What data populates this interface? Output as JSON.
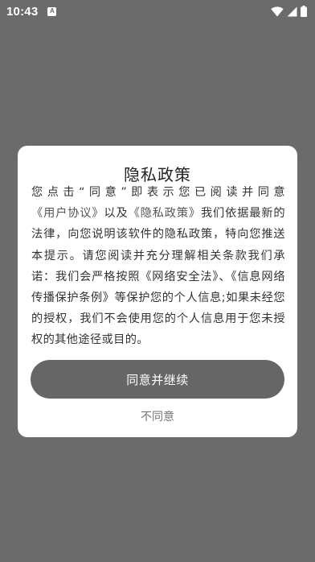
{
  "status_bar": {
    "time": "10:43",
    "notification_icon": "a-notification-icon",
    "wifi_icon": "wifi-icon",
    "signal_icon": "signal-icon",
    "battery_icon": "battery-icon"
  },
  "dialog": {
    "title": "隐私政策",
    "body": {
      "intro": "您点击“同意”即表示您已阅读并同意",
      "user_agreement_link": "《用户协议》",
      "and": "以及",
      "privacy_policy_link": "《隐私政策》",
      "rest": "我们依据最新的法律，向您说明该软件的隐私政策，特向您推送本提示。请您阅读并充分理解相关条款我们承诺：我们会严格按照《网络安全法》、《信息网络传播保护条例》等保护您的个人信息;如果未经您的授权，我们不会使用您的个人信息用于您未授权的其他途径或目的。"
    },
    "agree_label": "同意并继续",
    "disagree_label": "不同意"
  },
  "colors": {
    "overlay": "#6b6b6b",
    "dialog_bg": "#ffffff",
    "agree_button_bg": "#666666"
  }
}
